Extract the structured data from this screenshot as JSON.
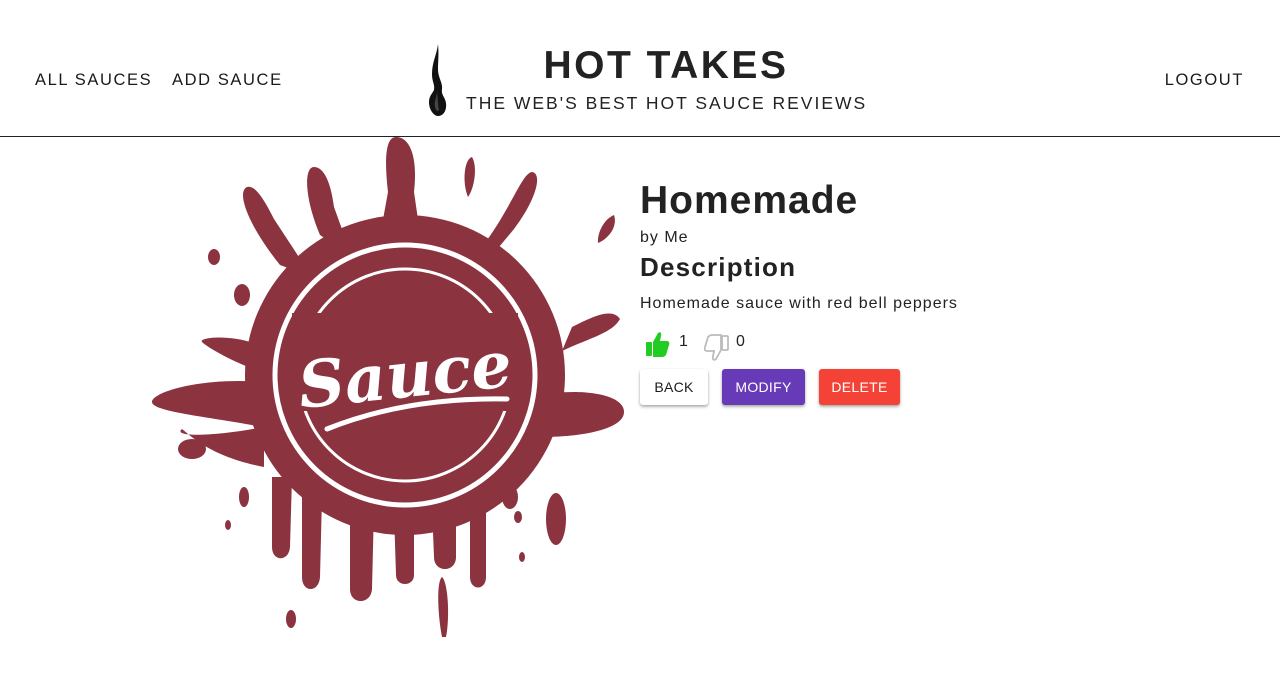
{
  "nav": {
    "all_sauces": "ALL SAUCES",
    "add_sauce": "ADD SAUCE",
    "logout": "LOGOUT"
  },
  "brand": {
    "title": "HOT TAKES",
    "tagline": "THE WEB'S BEST HOT SAUCE REVIEWS",
    "logo_icon": "flame-icon"
  },
  "sauce": {
    "image_text": "Sauce",
    "image_color": "#8b3440",
    "name": "Homemade",
    "by": "by Me",
    "description_heading": "Description",
    "description": "Homemade sauce with red bell peppers",
    "likes": "1",
    "dislikes": "0",
    "like_icon": "thumbs-up-icon",
    "dislike_icon": "thumbs-down-icon",
    "like_color": "#22cc22",
    "dislike_color": "#bbbbbb"
  },
  "actions": {
    "back": "BACK",
    "modify": "MODIFY",
    "delete": "DELETE",
    "modify_color": "#673ab7",
    "delete_color": "#f44336"
  }
}
